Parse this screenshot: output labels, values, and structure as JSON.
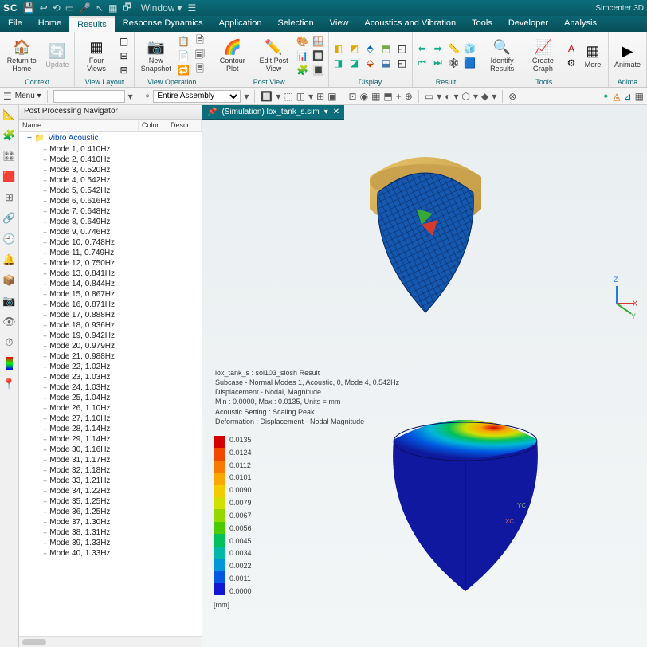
{
  "app": {
    "name": "Simcenter 3D",
    "logo": "SC"
  },
  "qat_window": "Window",
  "menu_tabs": [
    "File",
    "Home",
    "Results",
    "Response Dynamics",
    "Application",
    "Selection",
    "View",
    "Acoustics and Vibration",
    "Tools",
    "Developer",
    "Analysis"
  ],
  "menu_active_index": 2,
  "ribbon": {
    "context": {
      "return_home": "Return to Home",
      "update": "Update",
      "label": "Context"
    },
    "view_layout": {
      "four_views": "Four Views",
      "label": "View Layout"
    },
    "view_operation": {
      "new_snapshot": "New Snapshot",
      "label": "View Operation"
    },
    "post_view": {
      "contour_plot": "Contour Plot",
      "edit_post_view": "Edit Post View",
      "label": "Post View"
    },
    "display": {
      "label": "Display"
    },
    "result": {
      "label": "Result"
    },
    "tools": {
      "identify_results": "Identify Results",
      "create_graph": "Create Graph",
      "more": "More",
      "label": "Tools"
    },
    "animate": {
      "animate": "Animate",
      "label": "Anima"
    }
  },
  "toolstrip": {
    "menu": "Menu",
    "assembly": "Entire Assembly"
  },
  "navigator": {
    "title": "Post Processing Navigator",
    "cols": {
      "name": "Name",
      "color": "Color",
      "desc": "Descr"
    },
    "root": "Vibro Acoustic",
    "modes": [
      "Mode 1, 0.410Hz",
      "Mode 2, 0.410Hz",
      "Mode 3, 0.520Hz",
      "Mode 4, 0.542Hz",
      "Mode 5, 0.542Hz",
      "Mode 6, 0.616Hz",
      "Mode 7, 0.648Hz",
      "Mode 8, 0.649Hz",
      "Mode 9, 0.746Hz",
      "Mode 10, 0.748Hz",
      "Mode 11, 0.749Hz",
      "Mode 12, 0.750Hz",
      "Mode 13, 0.841Hz",
      "Mode 14, 0.844Hz",
      "Mode 15, 0.867Hz",
      "Mode 16, 0.871Hz",
      "Mode 17, 0.888Hz",
      "Mode 18, 0.936Hz",
      "Mode 19, 0.942Hz",
      "Mode 20, 0.979Hz",
      "Mode 21, 0.988Hz",
      "Mode 22, 1.02Hz",
      "Mode 23, 1.03Hz",
      "Mode 24, 1.03Hz",
      "Mode 25, 1.04Hz",
      "Mode 26, 1.10Hz",
      "Mode 27, 1.10Hz",
      "Mode 28, 1.14Hz",
      "Mode 29, 1.14Hz",
      "Mode 30, 1.16Hz",
      "Mode 31, 1.17Hz",
      "Mode 32, 1.18Hz",
      "Mode 33, 1.21Hz",
      "Mode 34, 1.22Hz",
      "Mode 35, 1.25Hz",
      "Mode 36, 1.25Hz",
      "Mode 37, 1.30Hz",
      "Mode 38, 1.31Hz",
      "Mode 39, 1.33Hz",
      "Mode 40, 1.33Hz"
    ]
  },
  "document_tab": {
    "label": "(Simulation) lox_tank_s.sim",
    "pinned": "📌"
  },
  "annotation": {
    "l1": "lox_tank_s : sol103_slosh Result",
    "l2": "Subcase - Normal Modes 1, Acoustic, 0, Mode 4, 0.542Hz",
    "l3": "Displacement - Nodal, Magnitude",
    "l4": "Min : 0.0000, Max : 0.0135, Units = mm",
    "l5": "Acoustic Setting : Scaling Peak",
    "l6": "Deformation : Displacement - Nodal Magnitude"
  },
  "legend": {
    "values": [
      "0.0135",
      "0.0124",
      "0.0112",
      "0.0101",
      "0.0090",
      "0.0079",
      "0.0067",
      "0.0056",
      "0.0045",
      "0.0034",
      "0.0022",
      "0.0011",
      "0.0000"
    ],
    "colors": [
      "#d40000",
      "#f04a00",
      "#f97a00",
      "#f9a800",
      "#f2cc00",
      "#d2e000",
      "#94d800",
      "#4acc00",
      "#00c05c",
      "#00b8a8",
      "#0098d8",
      "#0058e0",
      "#1018d0"
    ],
    "unit": "[mm]"
  },
  "triad": {
    "x": "X",
    "y": "Y",
    "z": "Z"
  },
  "axis_small": {
    "xc": "XC",
    "yc": "YC"
  }
}
